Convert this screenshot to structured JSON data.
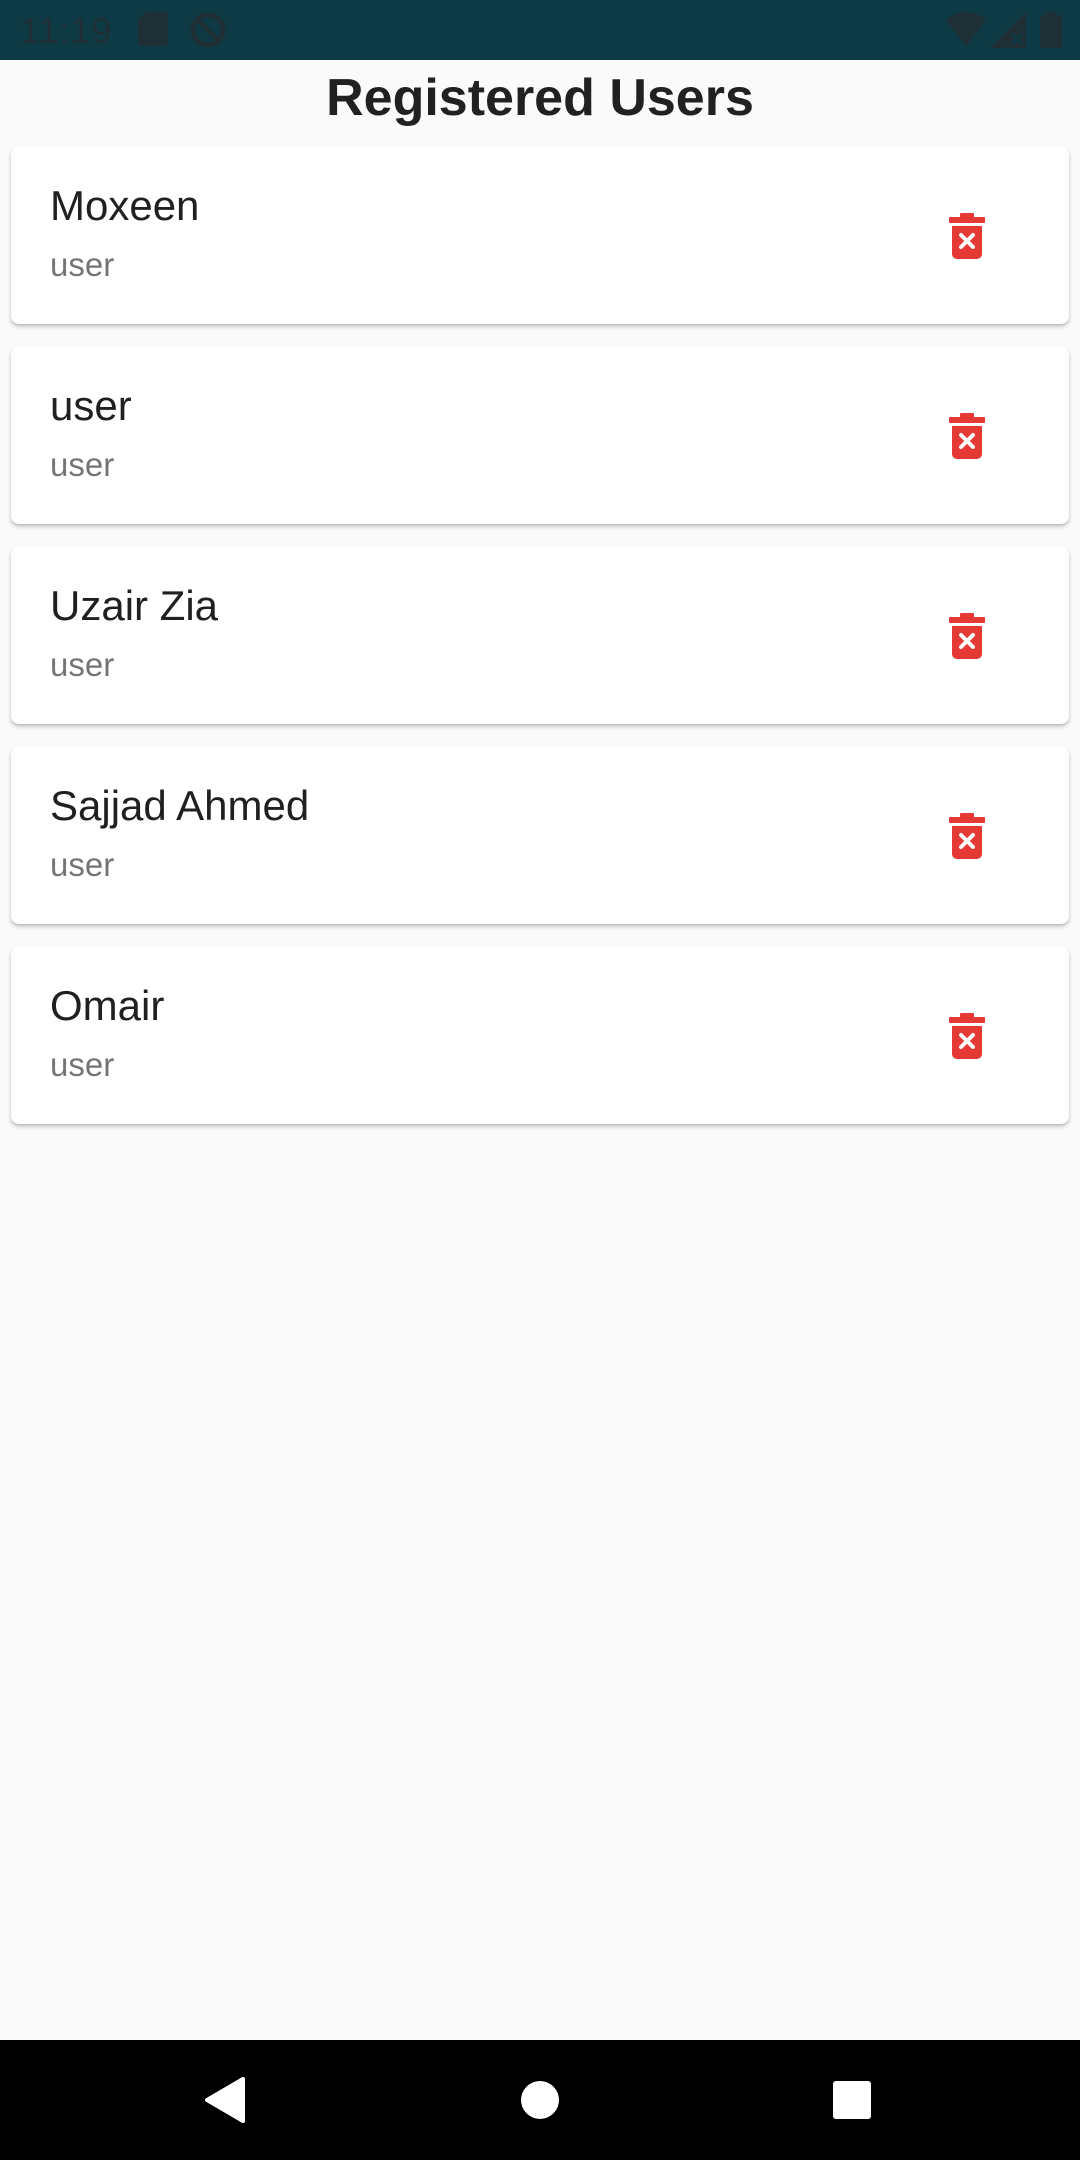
{
  "status_bar": {
    "time": "11:19",
    "icons": [
      "sd-card-icon",
      "cast-icon",
      "wifi-icon",
      "signal-icon",
      "battery-icon"
    ]
  },
  "page": {
    "title": "Registered Users"
  },
  "users": [
    {
      "name": "Moxeen",
      "role": "user"
    },
    {
      "name": "user",
      "role": "user"
    },
    {
      "name": "Uzair Zia",
      "role": "user"
    },
    {
      "name": "Sajjad Ahmed",
      "role": "user"
    },
    {
      "name": "Omair",
      "role": "user"
    }
  ],
  "navigation": {
    "icons": [
      "back-icon",
      "home-icon",
      "recents-icon"
    ]
  },
  "colors": {
    "status_bar": "#0d3a45",
    "delete_icon": "#e53935",
    "background": "#fafafa"
  }
}
